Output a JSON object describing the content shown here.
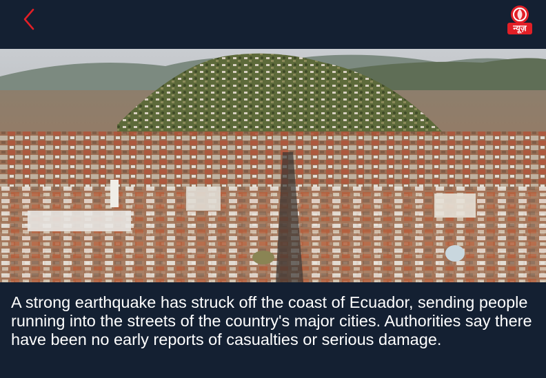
{
  "header": {
    "back_icon": "chevron-left-icon",
    "logo_text": "न्यूज़",
    "logo_icon": "dd-news-logo",
    "accent_color": "#e21f26"
  },
  "hero": {
    "description": "Aerial photo of a dense city of terracotta roofs and white buildings below a green hill"
  },
  "article": {
    "text": "A strong earthquake has struck off the coast of Ecuador, sending people running into the streets of the country's major cities. Authorities say there have been no early reports of casualties or serious damage."
  }
}
